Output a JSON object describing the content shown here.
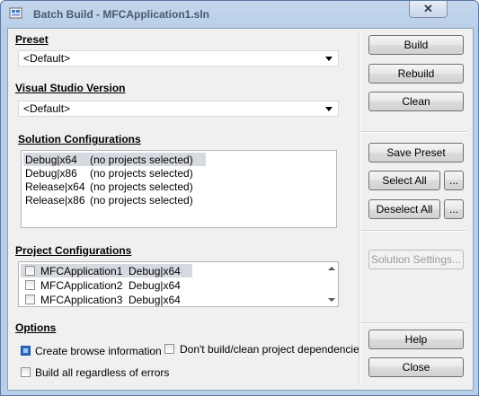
{
  "window": {
    "title": "Batch Build - MFCApplication1.sln",
    "close_glyph": "✕"
  },
  "preset": {
    "label": "Preset",
    "value": "<Default>"
  },
  "vs_version": {
    "label": "Visual Studio Version",
    "value": "<Default>"
  },
  "solution_configs": {
    "label": "Solution Configurations",
    "rows": [
      {
        "config": "Debug|x64",
        "status": "(no projects selected)",
        "selected": true
      },
      {
        "config": "Debug|x86",
        "status": "(no projects selected)",
        "selected": false
      },
      {
        "config": "Release|x64",
        "status": "(no projects selected)",
        "selected": false
      },
      {
        "config": "Release|x86",
        "status": "(no projects selected)",
        "selected": false
      }
    ]
  },
  "project_configs": {
    "label": "Project Configurations",
    "rows": [
      {
        "project": "MFCApplication1",
        "config": "Debug|x64",
        "checked": false,
        "selected": true
      },
      {
        "project": "MFCApplication2",
        "config": "Debug|x64",
        "checked": false,
        "selected": false
      },
      {
        "project": "MFCApplication3",
        "config": "Debug|x64",
        "checked": false,
        "selected": false
      }
    ]
  },
  "options": {
    "label": "Options",
    "create_browse": {
      "label": "Create browse information",
      "checked": true
    },
    "build_all": {
      "label": "Build all regardless of errors",
      "checked": false
    },
    "dont_build_deps": {
      "label": "Don't build/clean project dependencie",
      "checked": false
    }
  },
  "buttons": {
    "build": "Build",
    "rebuild": "Rebuild",
    "clean": "Clean",
    "save_preset": "Save Preset",
    "select_all": "Select All",
    "select_all_more": "...",
    "deselect_all": "Deselect All",
    "deselect_all_more": "...",
    "solution_settings": "Solution Settings...",
    "help": "Help",
    "close": "Close"
  }
}
